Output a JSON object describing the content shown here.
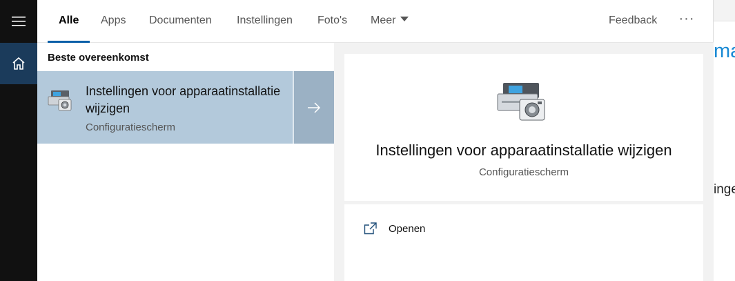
{
  "tabs": [
    {
      "label": "Alle",
      "active": true
    },
    {
      "label": "Apps",
      "active": false
    },
    {
      "label": "Documenten",
      "active": false
    },
    {
      "label": "Instellingen",
      "active": false
    },
    {
      "label": "Foto's",
      "active": false
    },
    {
      "label": "Meer",
      "active": false
    }
  ],
  "header": {
    "feedback_label": "Feedback",
    "more_options_label": "···"
  },
  "results": {
    "section_label": "Beste overeenkomst",
    "best_match": {
      "title": "Instellingen voor apparaatinstallatie wijzigen",
      "subtitle": "Configuratiescherm",
      "icon": "device-installation-settings-icon"
    }
  },
  "preview": {
    "title": "Instellingen voor apparaatinstallatie wijzigen",
    "subtitle": "Configuratiescherm",
    "icon": "device-installation-settings-icon",
    "actions": [
      {
        "label": "Openen",
        "icon": "open-external-icon"
      }
    ]
  },
  "background": {
    "fragment_1": "ma",
    "fragment_2": "inge"
  },
  "colors": {
    "rail": "#111111",
    "rail_active": "#1b3b5b",
    "accent": "#0b5fa8",
    "selected_result": "#b3c9db",
    "arrow_bg": "#9bb1c4",
    "link_blue": "#1a8ad4"
  }
}
